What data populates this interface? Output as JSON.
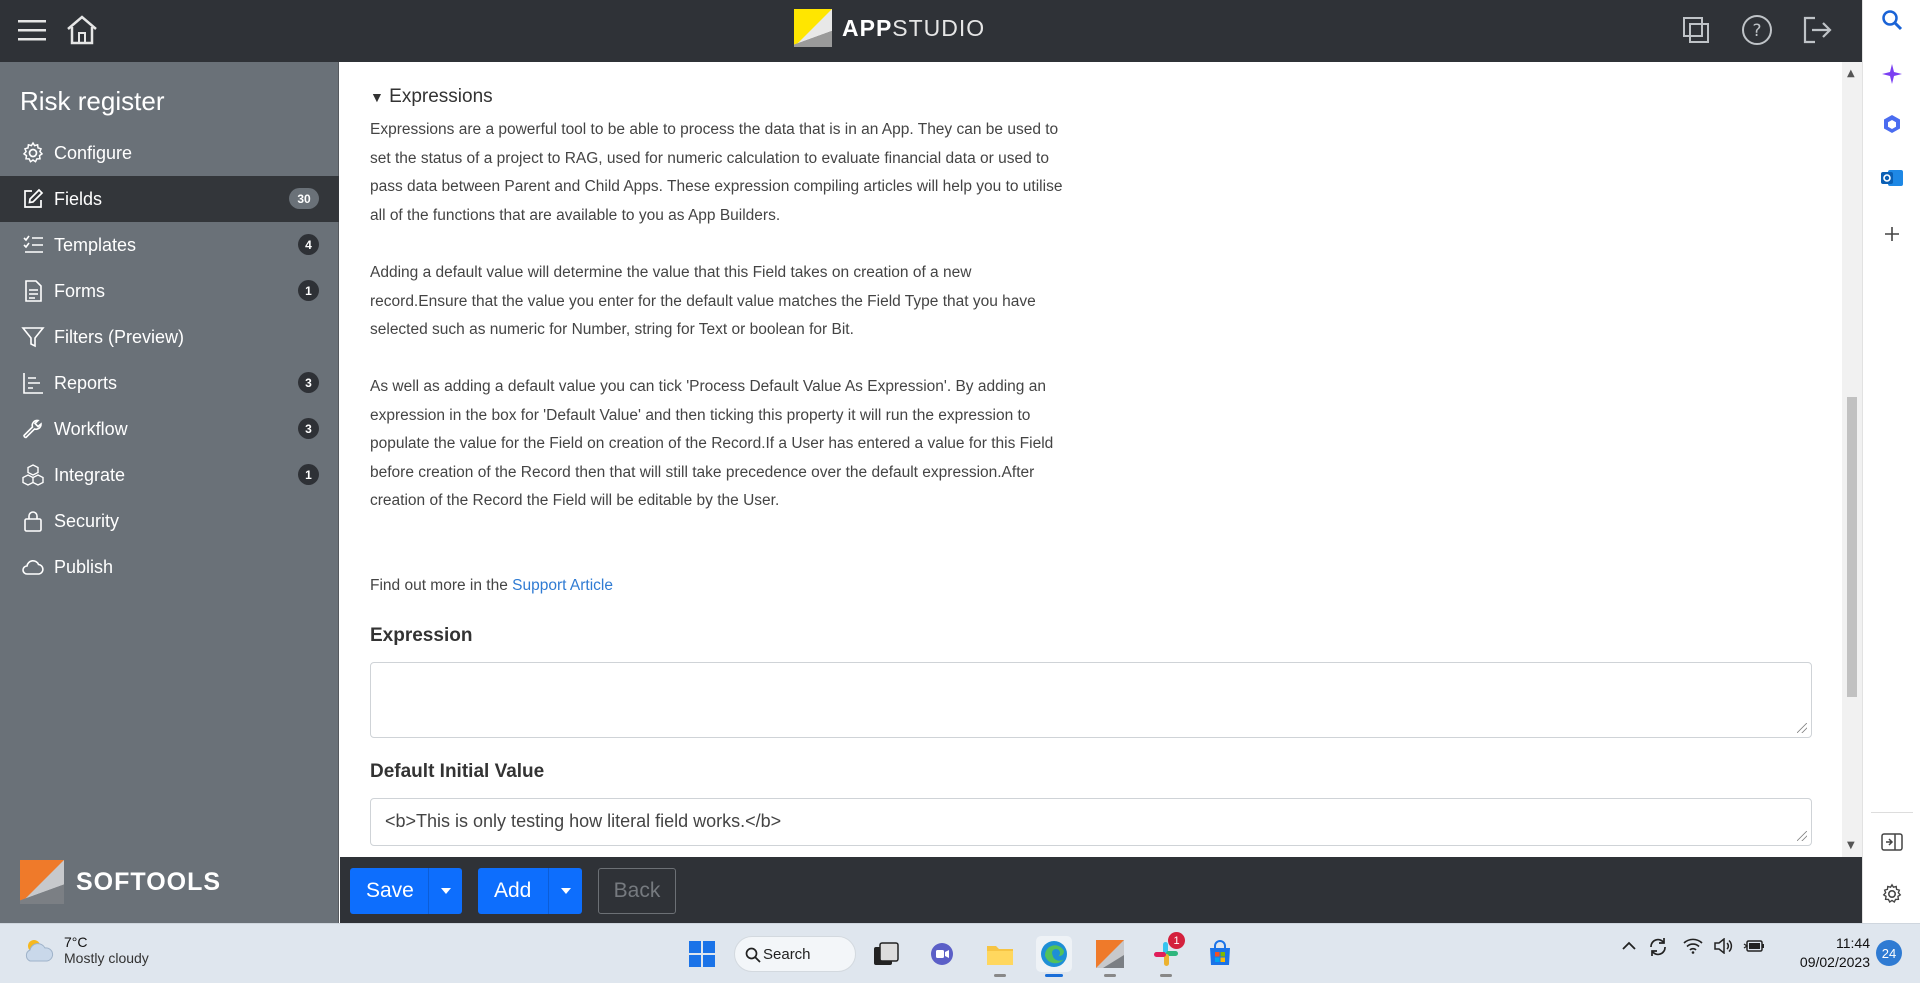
{
  "topbar": {
    "brand_bold": "APP",
    "brand_light": "STUDIO"
  },
  "sidebar": {
    "title": "Risk register",
    "items": [
      {
        "label": "Configure",
        "icon": "gear-icon",
        "count": ""
      },
      {
        "label": "Fields",
        "icon": "edit-icon",
        "count": "30"
      },
      {
        "label": "Templates",
        "icon": "checklist-icon",
        "count": "4"
      },
      {
        "label": "Forms",
        "icon": "document-icon",
        "count": "1"
      },
      {
        "label": "Filters (Preview)",
        "icon": "filter-icon",
        "count": ""
      },
      {
        "label": "Reports",
        "icon": "report-icon",
        "count": "3"
      },
      {
        "label": "Workflow",
        "icon": "wrench-icon",
        "count": "3"
      },
      {
        "label": "Integrate",
        "icon": "blocks-icon",
        "count": "1"
      },
      {
        "label": "Security",
        "icon": "lock-icon",
        "count": ""
      },
      {
        "label": "Publish",
        "icon": "cloud-icon",
        "count": ""
      }
    ],
    "footer_brand": "SOFTOOLS"
  },
  "main": {
    "summary": "Expressions",
    "para1": "Expressions are a powerful tool to be able to process the data that is in an App. They can be used to set the status of a project to RAG, used for numeric calculation to evaluate financial data or used to pass data between Parent and Child Apps. These expression compiling articles will help you to utilise all of the functions that are available to you as App Builders.",
    "para2": "Adding a default value will determine the value that this Field takes on creation of a new record.Ensure that the value you enter for the default value matches the Field Type that you have selected such as numeric for Number, string for Text or boolean for Bit.",
    "para3": "As well as adding a default value you can tick 'Process Default Value As Expression'. By adding an expression in the box for 'Default Value' and then ticking this property it will run the expression to populate the value for the Field on creation of the Record.If a User has entered a value for this Field before creation of the Record then that will still take precedence over the default expression.After creation of the Record the Field will be editable by the User.",
    "find_more": "Find out more in the ",
    "support_link": "Support Article",
    "expression_label": "Expression",
    "expression_value": "",
    "default_label": "Default Initial Value",
    "default_value": "<b>This is only testing how literal field works.</b>"
  },
  "bottombar": {
    "save": "Save",
    "add": "Add",
    "back": "Back"
  },
  "taskbar": {
    "temp": "7°C",
    "weather": "Mostly cloudy",
    "search": "Search",
    "time": "11:44",
    "date": "09/02/2023",
    "notifications": "24",
    "slack_badge": "1"
  }
}
